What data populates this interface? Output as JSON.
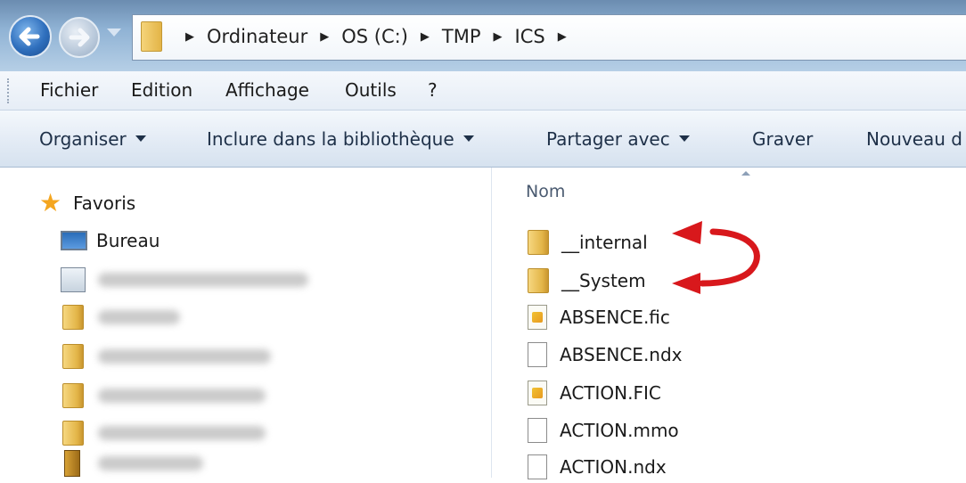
{
  "address_bar": {
    "crumbs": [
      "Ordinateur",
      "OS (C:)",
      "TMP",
      "ICS"
    ]
  },
  "menu": {
    "items": [
      "Fichier",
      "Edition",
      "Affichage",
      "Outils",
      "?"
    ]
  },
  "toolbar": {
    "organize": "Organiser",
    "include": "Inclure dans la bibliothèque",
    "share": "Partager avec",
    "burn": "Graver",
    "new_folder": "Nouveau d"
  },
  "nav": {
    "favorites": "Favoris",
    "desktop": "Bureau"
  },
  "files": {
    "column_name": "Nom",
    "items": [
      "__internal",
      "__System",
      "ABSENCE.fic",
      "ABSENCE.ndx",
      "ACTION.FIC",
      "ACTION.mmo",
      "ACTION.ndx"
    ]
  },
  "colors": {
    "annotation_arrow": "#d8181c",
    "folder": "#e3b447",
    "command_bar": "#dde7f2"
  }
}
